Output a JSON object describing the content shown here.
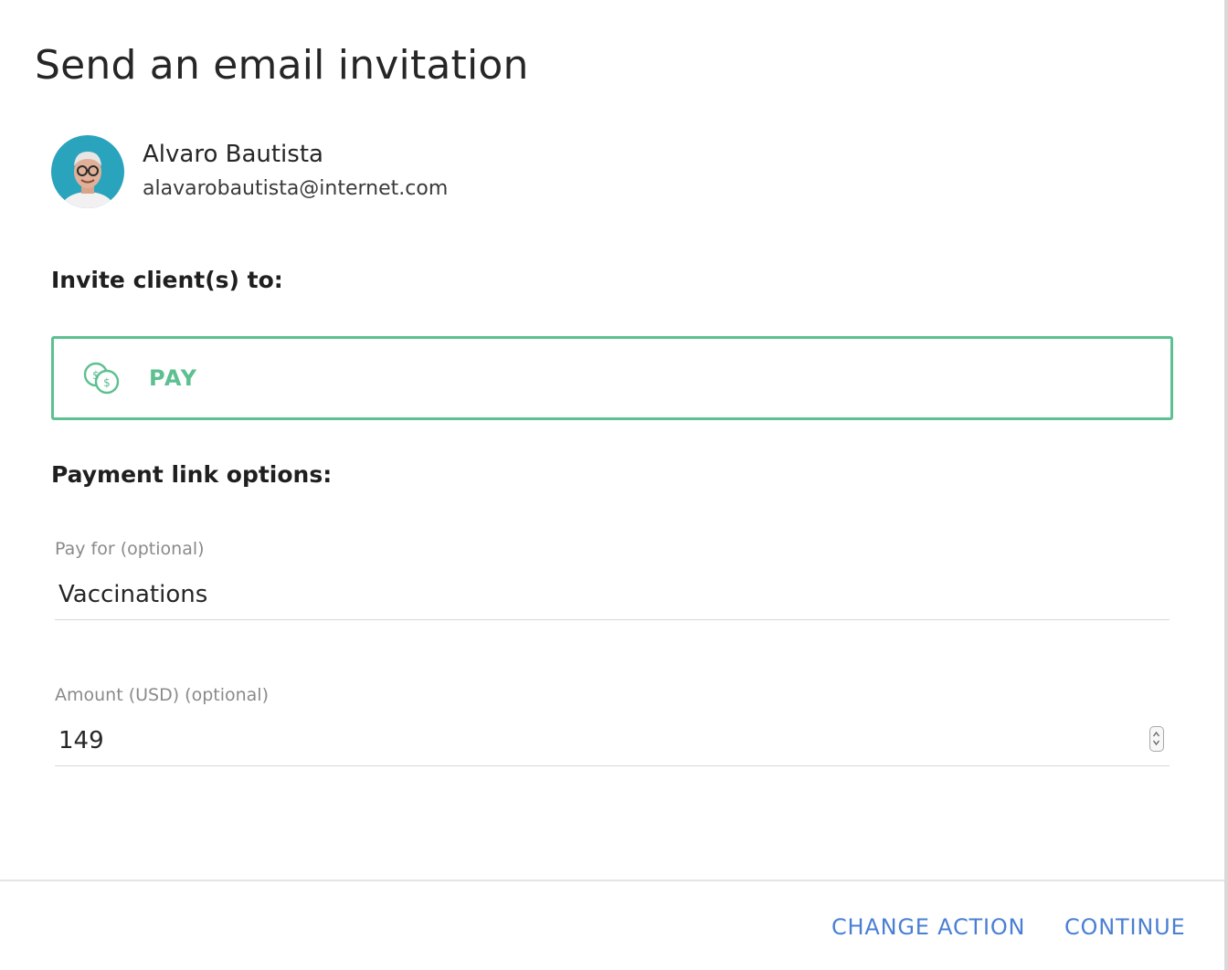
{
  "dialog": {
    "title": "Send an email invitation"
  },
  "client": {
    "name": "Alvaro Bautista",
    "email": "alavarobautista@internet.com",
    "avatar_icon": "person-photo-avatar"
  },
  "invite": {
    "label": "Invite client(s) to:",
    "action": {
      "label": "PAY",
      "icon": "coins-icon",
      "accent_color": "#5cc091"
    }
  },
  "payment_options": {
    "label": "Payment link options:",
    "pay_for": {
      "label": "Pay for (optional)",
      "value": "Vaccinations"
    },
    "amount": {
      "label": "Amount (USD) (optional)",
      "value": "149"
    }
  },
  "footer": {
    "change_action_label": "CHANGE ACTION",
    "continue_label": "CONTINUE",
    "button_color": "#4a7fd4"
  }
}
